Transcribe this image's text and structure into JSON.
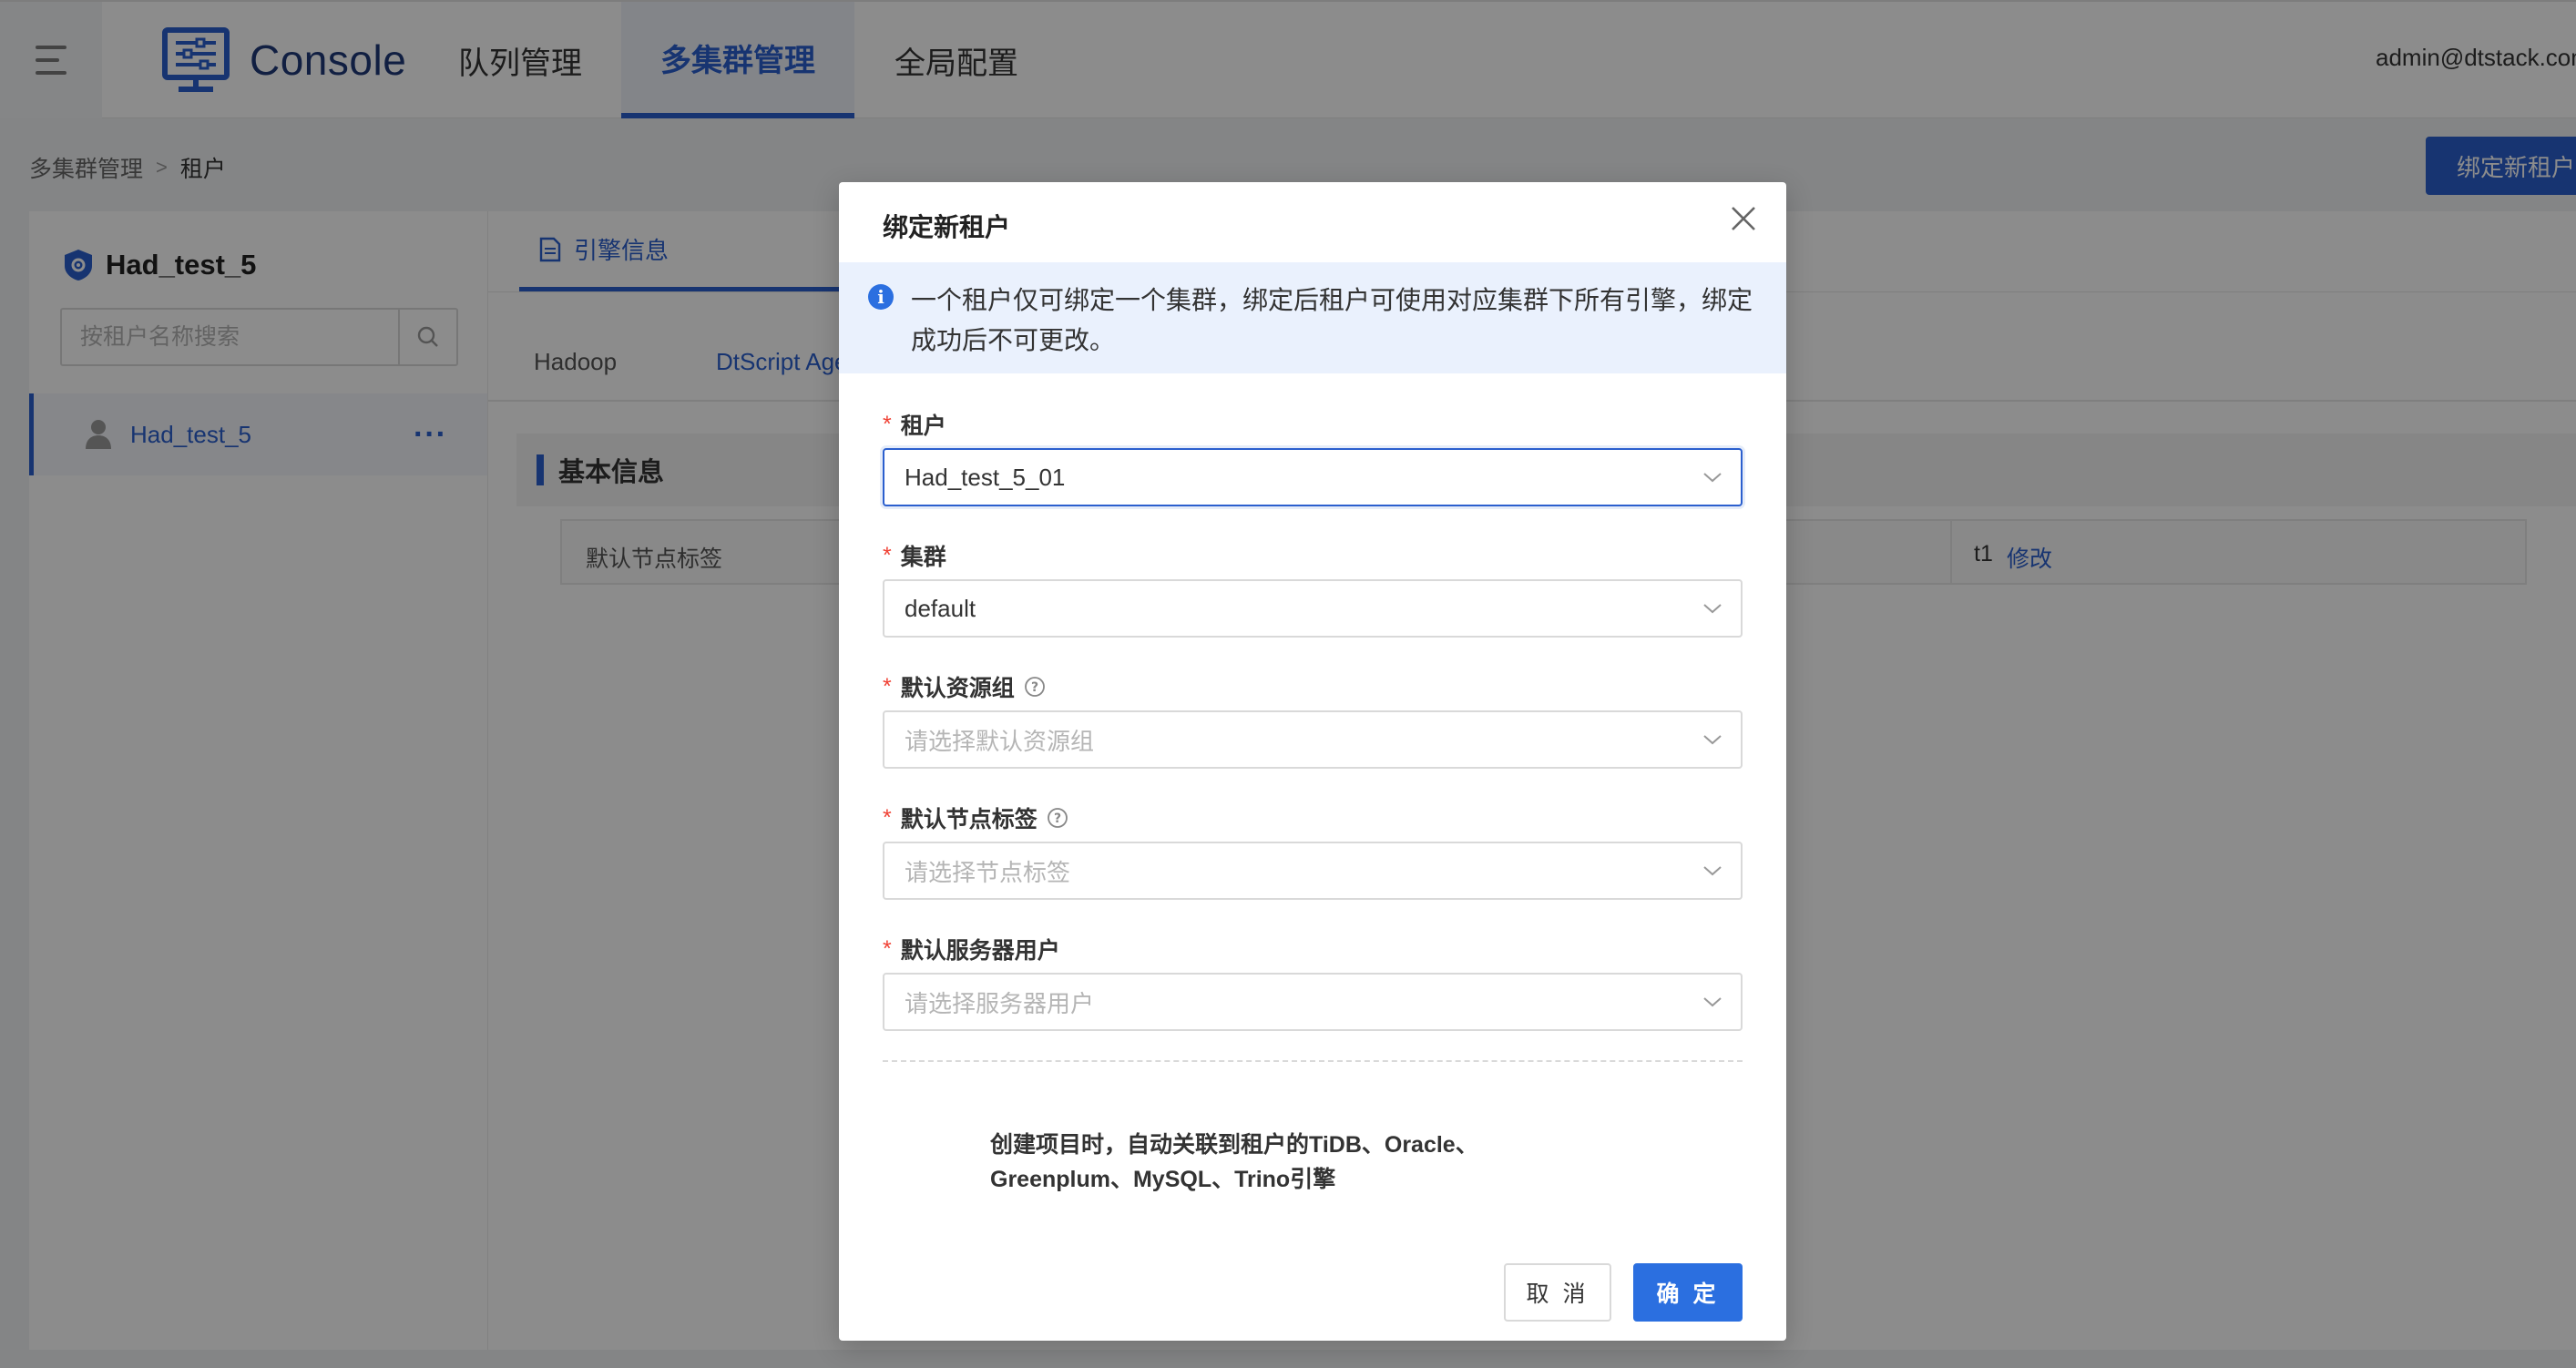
{
  "header": {
    "logo_text": "Console",
    "nav": [
      {
        "label": "队列管理",
        "active": false
      },
      {
        "label": "多集群管理",
        "active": true
      },
      {
        "label": "全局配置",
        "active": false
      }
    ],
    "user_email": "admin@dtstack.com"
  },
  "breadcrumb": {
    "items": [
      "多集群管理",
      "租户"
    ]
  },
  "bind_tenant_button": "绑定新租户",
  "left_panel": {
    "title": "Had_test_5",
    "search_placeholder": "按租户名称搜索",
    "tenants": [
      {
        "name": "Had_test_5",
        "more": "···"
      }
    ]
  },
  "content": {
    "engine_tab": "引擎信息",
    "sub_tabs": [
      "Hadoop",
      "DtScript Age"
    ],
    "section_title": "基本信息",
    "table": {
      "label": "默认节点标签",
      "value": "t1",
      "action": "修改"
    }
  },
  "modal": {
    "title": "绑定新租户",
    "alert": "一个租户仅可绑定一个集群，绑定后租户可使用对应集群下所有引擎，绑定成功后不可更改。",
    "fields": {
      "tenant": {
        "label": "租户",
        "value": "Had_test_5_01"
      },
      "cluster": {
        "label": "集群",
        "value": "default"
      },
      "resource_group": {
        "label": "默认资源组",
        "placeholder": "请选择默认资源组"
      },
      "node_label": {
        "label": "默认节点标签",
        "placeholder": "请选择节点标签"
      },
      "server_user": {
        "label": "默认服务器用户",
        "placeholder": "请选择服务器用户"
      }
    },
    "note": "创建项目时，自动关联到租户的TiDB、Oracle、Greenplum、MySQL、Trino引擎",
    "cancel": "取 消",
    "ok": "确 定"
  },
  "colors": {
    "primary": "#2b5fce",
    "required": "#f04134"
  }
}
